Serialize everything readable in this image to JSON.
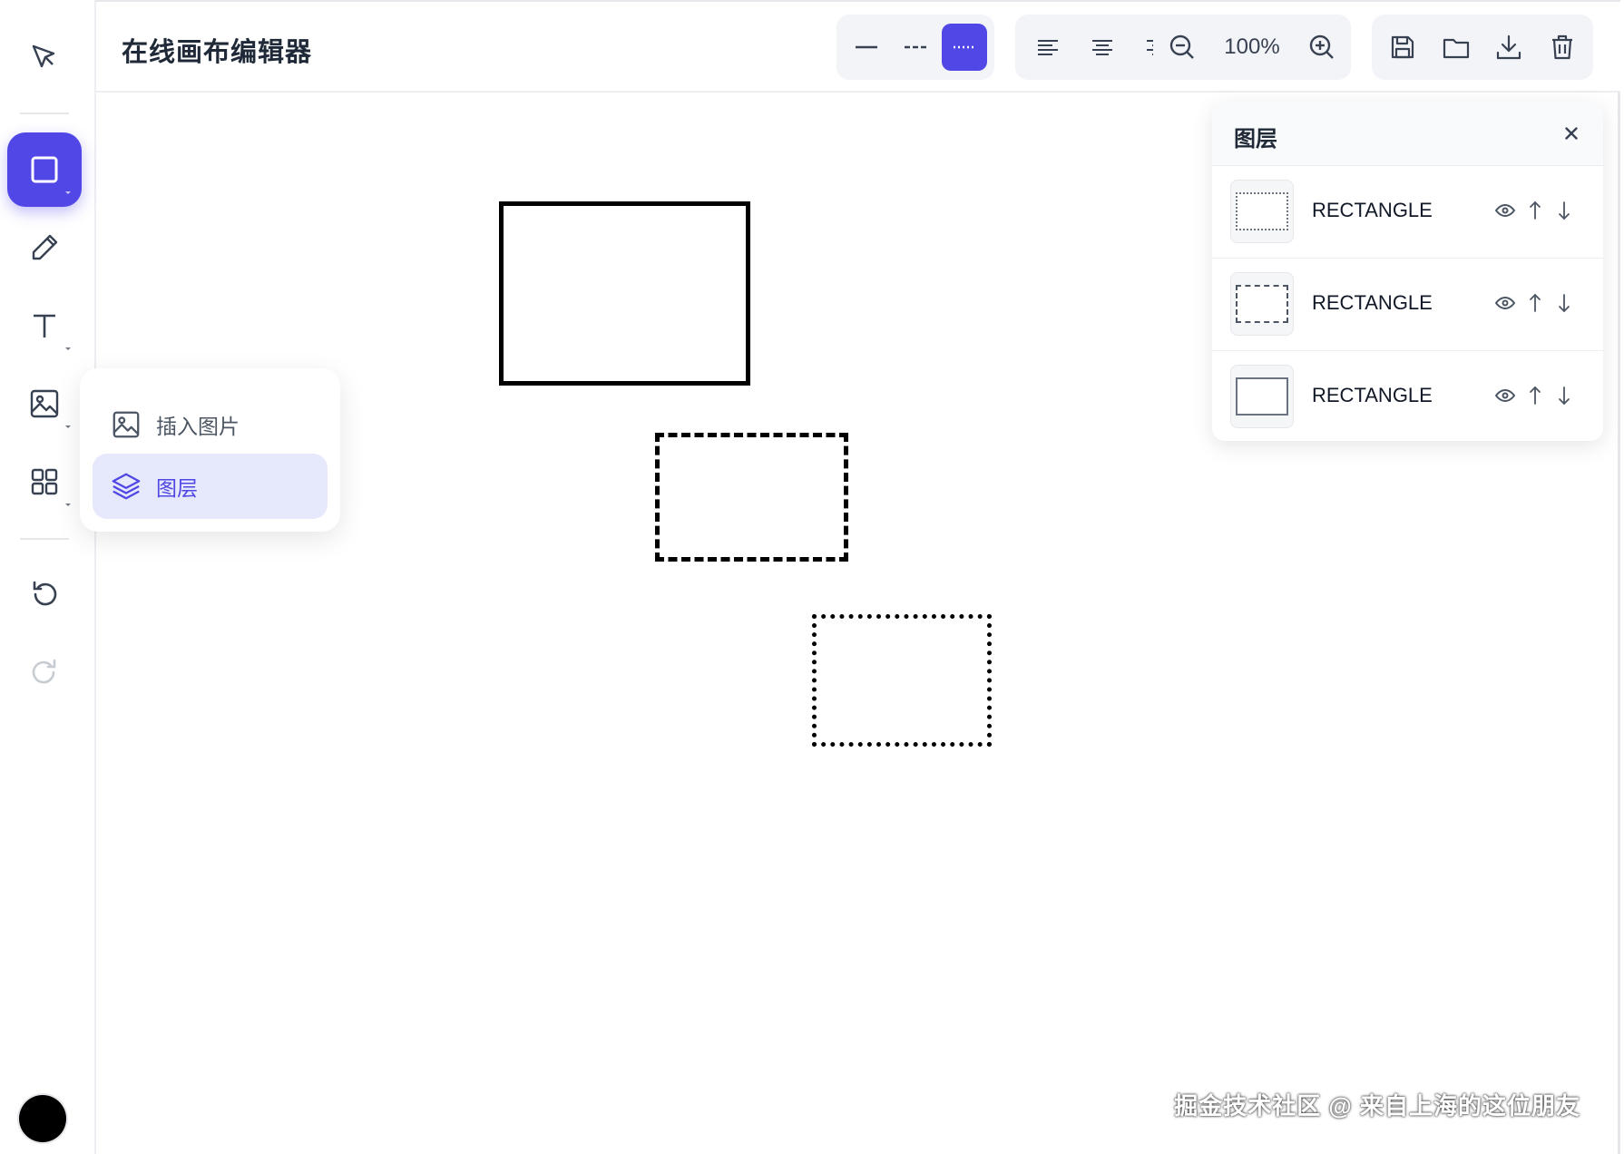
{
  "header": {
    "title": "在线画布编辑器",
    "zoom_level": "100%"
  },
  "sidebar": {
    "tools": [
      {
        "name": "select",
        "icon": "cursor-arrow-icon"
      },
      {
        "name": "rectangle",
        "icon": "square-icon",
        "active": true
      },
      {
        "name": "pencil",
        "icon": "pencil-icon"
      },
      {
        "name": "text",
        "icon": "text-icon"
      },
      {
        "name": "image",
        "icon": "image-icon"
      },
      {
        "name": "more",
        "icon": "grid-icon"
      },
      {
        "name": "undo",
        "icon": "undo-icon"
      },
      {
        "name": "redo",
        "icon": "redo-icon",
        "disabled": true
      }
    ],
    "current_color": "#000000"
  },
  "popup_menu": {
    "items": [
      {
        "label": "插入图片",
        "icon": "image-icon"
      },
      {
        "label": "图层",
        "icon": "layers-icon",
        "active": true
      }
    ]
  },
  "layers_panel": {
    "title": "图层",
    "layers": [
      {
        "name": "RECTANGLE",
        "style": "dotted"
      },
      {
        "name": "RECTANGLE",
        "style": "dashed"
      },
      {
        "name": "RECTANGLE",
        "style": "solid"
      }
    ]
  },
  "line_style": {
    "options": [
      "solid",
      "dashed",
      "dotted"
    ],
    "selected": "dotted"
  },
  "align": {
    "options": [
      "left",
      "center",
      "right"
    ]
  },
  "file_actions": [
    "save-icon",
    "folder-icon",
    "download-icon",
    "trash-icon"
  ],
  "colors": {
    "accent": "#5047e6",
    "accent_light": "#e6e8fb"
  },
  "watermark": "掘金技术社区 @ 来自上海的这位朋友"
}
